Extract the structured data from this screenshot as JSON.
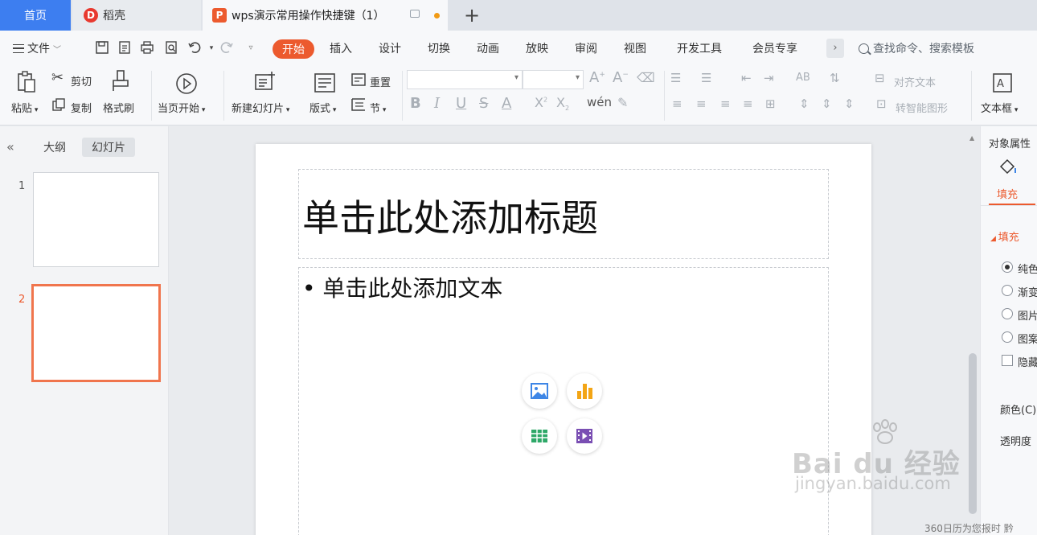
{
  "tabs": {
    "home": "首页",
    "docer": "稻壳",
    "docer_logo": "D",
    "document": "wps演示常用操作快捷键（1）",
    "doc_logo": "P",
    "add": "+"
  },
  "menu": {
    "file": "文件",
    "items": [
      "开始",
      "插入",
      "设计",
      "切换",
      "动画",
      "放映",
      "审阅",
      "视图",
      "开发工具",
      "会员专享"
    ],
    "more": "›",
    "search_placeholder": "查找命令、搜索模板"
  },
  "ribbon": {
    "paste": "粘贴",
    "cut": "剪切",
    "copy": "复制",
    "format_painter": "格式刷",
    "from_current": "当页开始",
    "new_slide": "新建幻灯片",
    "layout": "版式",
    "reset": "重置",
    "section": "节",
    "align_text": "对齐文本",
    "smart_shape": "转智能图形",
    "textbox": "文本框"
  },
  "left_pane": {
    "tab_outline": "大纲",
    "tab_slides": "幻灯片",
    "slides": [
      {
        "number": "1",
        "selected": false
      },
      {
        "number": "2",
        "selected": true
      }
    ]
  },
  "slide": {
    "title_placeholder": "单击此处添加标题",
    "body_placeholder": "• 单击此处添加文本",
    "insert_icons": [
      "picture-icon",
      "chart-icon",
      "table-icon",
      "video-icon"
    ]
  },
  "properties": {
    "title": "对象属性",
    "tab_fill": "填充",
    "section_fill": "填充",
    "options": [
      {
        "label": "纯色",
        "type": "radio",
        "checked": true
      },
      {
        "label": "渐变",
        "type": "radio",
        "checked": false
      },
      {
        "label": "图片",
        "type": "radio",
        "checked": false
      },
      {
        "label": "图案",
        "type": "radio",
        "checked": false
      },
      {
        "label": "隐藏",
        "type": "checkbox",
        "checked": false
      }
    ],
    "color_label": "颜色(C)",
    "transparency_label": "透明度"
  },
  "watermark": {
    "brand": "Bai du 经验",
    "url": "jingyan.baidu.com"
  },
  "notice": "360日历为您报时 黔",
  "colors": {
    "accent": "#ec5a2e",
    "home_tab": "#3d7ef0",
    "selected_thumb": "#f0754d"
  }
}
